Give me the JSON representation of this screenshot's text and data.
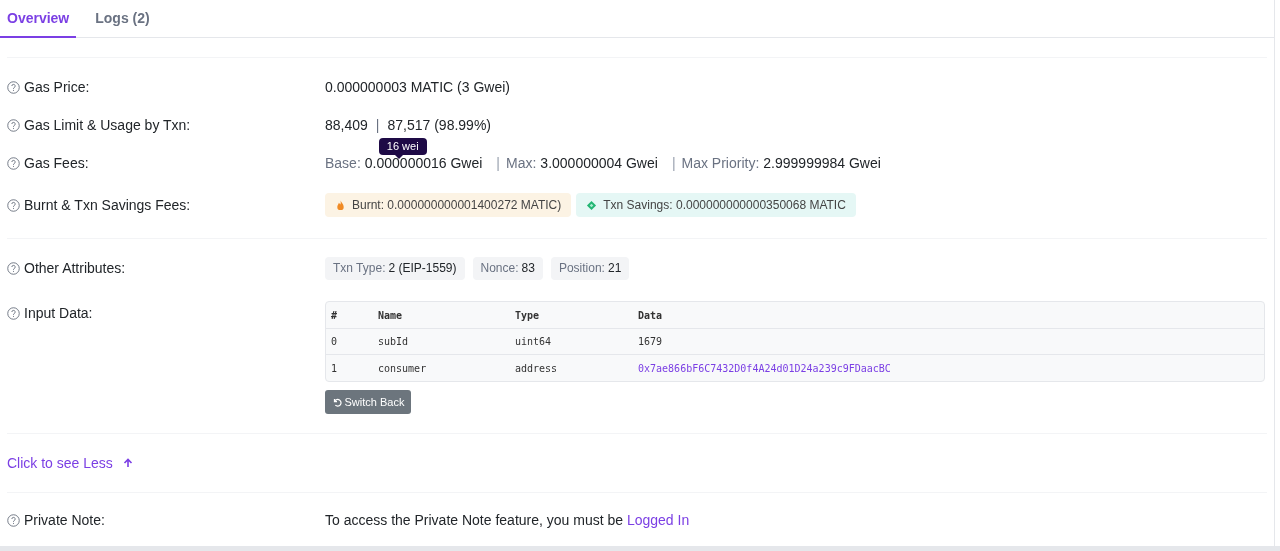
{
  "tabs": [
    {
      "label": "Overview",
      "selected": true
    },
    {
      "label": "Logs (2)",
      "selected": false
    }
  ],
  "gas_price": {
    "label": "Gas Price:",
    "value": "0.000000003 MATIC (3 Gwei)"
  },
  "gas_limit": {
    "label": "Gas Limit & Usage by Txn:",
    "limit": "88,409",
    "separator": "|",
    "usage": "87,517 (98.99%)"
  },
  "gas_fees": {
    "label": "Gas Fees:",
    "tooltip": "16 wei",
    "parts": [
      {
        "name": "Base:",
        "value": "0.000000016 Gwei"
      },
      {
        "name": "Max:",
        "value": "3.000000004 Gwei"
      },
      {
        "name": "Max Priority:",
        "value": "2.999999984 Gwei"
      }
    ],
    "separator": "|"
  },
  "burnt_savings": {
    "label": "Burnt & Txn Savings Fees:",
    "badges": [
      {
        "kind": "burnt",
        "text": "Burnt: 0.000000000001400272 MATIC)"
      },
      {
        "kind": "savings",
        "text": "Txn Savings: 0.000000000000350068 MATIC"
      }
    ]
  },
  "other_attributes": {
    "label": "Other Attributes:",
    "badges": [
      {
        "name": "Txn Type:",
        "value": "2 (EIP-1559)"
      },
      {
        "name": "Nonce:",
        "value": "83"
      },
      {
        "name": "Position:",
        "value": "21"
      }
    ]
  },
  "input_data": {
    "label": "Input Data:",
    "columns": [
      "#",
      "Name",
      "Type",
      "Data"
    ],
    "rows": [
      {
        "index": "0",
        "name": "subId",
        "type": "uint64",
        "data": "1679",
        "kind": "plain"
      },
      {
        "index": "1",
        "name": "consumer",
        "type": "address",
        "data": "0x7ae866bF6C7432D0f4A24d01D24a239c9FDaacBC",
        "kind": "link"
      }
    ],
    "button": "Switch Back"
  },
  "see_less": "Click to see Less",
  "private_note": {
    "label": "Private Note:",
    "text": "To access the Private Note feature, you must be",
    "link": "Logged In"
  }
}
